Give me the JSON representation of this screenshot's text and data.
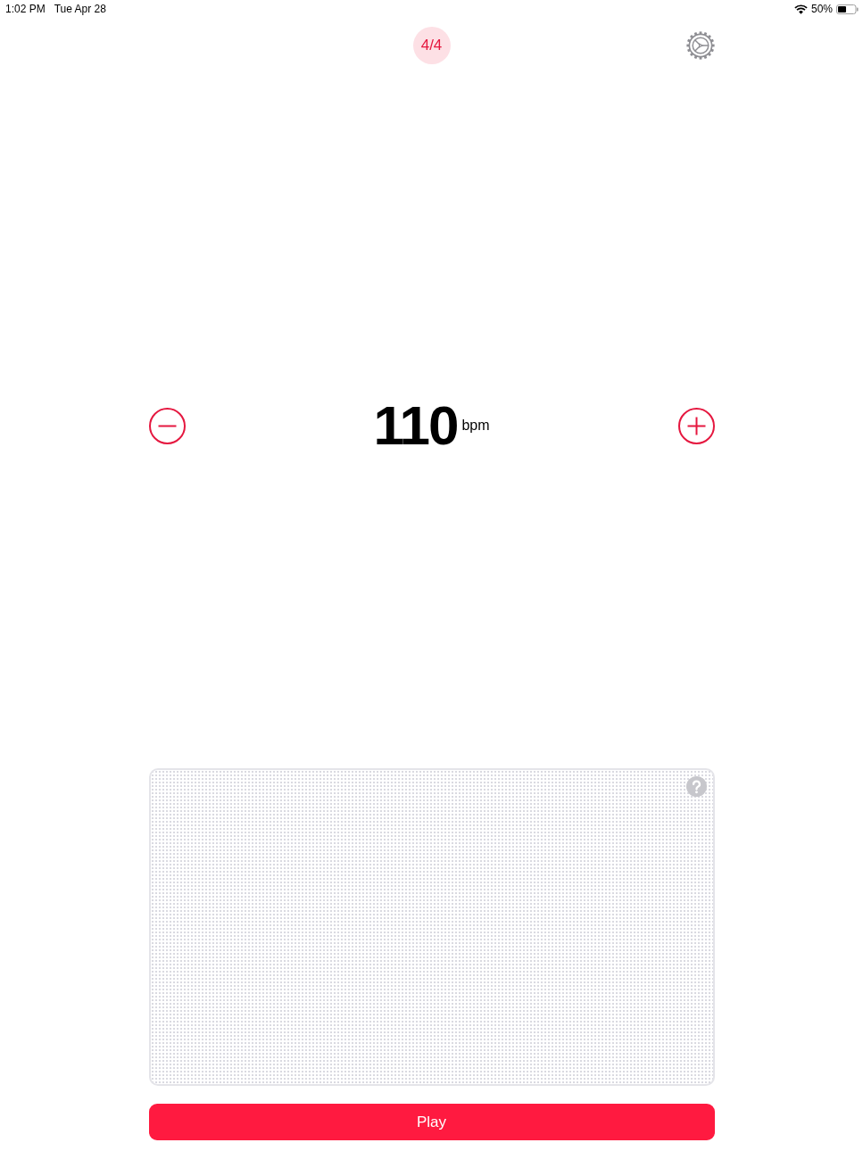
{
  "status_bar": {
    "time": "1:02 PM",
    "date": "Tue Apr 28",
    "battery_text": "50%"
  },
  "toolbar": {
    "time_signature": "4/4"
  },
  "tempo": {
    "value": "110",
    "unit": "bpm"
  },
  "play_button": {
    "label": "Play"
  }
}
